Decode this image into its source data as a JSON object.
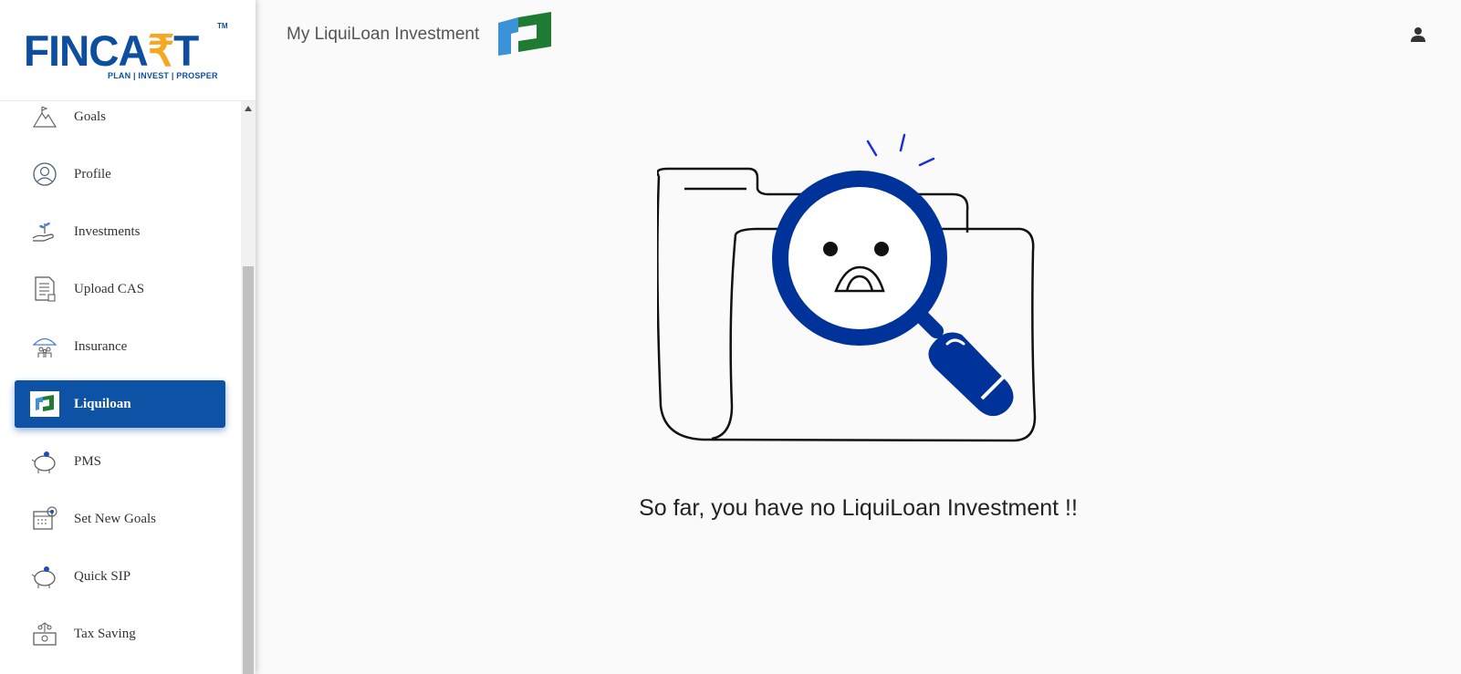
{
  "brand": {
    "logo_text_left": "FINCA",
    "logo_text_rupee": "₹",
    "logo_text_right": "T",
    "logo_tm": "TM",
    "logo_tagline": "PLAN | INVEST | PROSPER",
    "primary_color": "#0d52a5",
    "accent_color": "#f5a623"
  },
  "sidebar": {
    "items": [
      {
        "label": "Goals",
        "icon": "goals-mountain-icon",
        "active": false
      },
      {
        "label": "Profile",
        "icon": "profile-icon",
        "active": false
      },
      {
        "label": "Investments",
        "icon": "investments-hand-icon",
        "active": false
      },
      {
        "label": "Upload CAS",
        "icon": "document-icon",
        "active": false
      },
      {
        "label": "Insurance",
        "icon": "umbrella-family-icon",
        "active": false
      },
      {
        "label": "Liquiloan",
        "icon": "liquiloan-icon",
        "active": true
      },
      {
        "label": "PMS",
        "icon": "piggy-bank-icon",
        "active": false
      },
      {
        "label": "Set New Goals",
        "icon": "calendar-target-icon",
        "active": false
      },
      {
        "label": "Quick SIP",
        "icon": "piggy-bank-icon",
        "active": false
      },
      {
        "label": "Tax Saving",
        "icon": "tax-saving-icon",
        "active": false
      }
    ]
  },
  "header": {
    "title": "My LiquiLoan Investment",
    "user_icon": "user-icon"
  },
  "main": {
    "empty_message": "So far, you have no LiquiLoan Investment !!",
    "illustration": "folder-magnifier-sad-face-illustration"
  }
}
